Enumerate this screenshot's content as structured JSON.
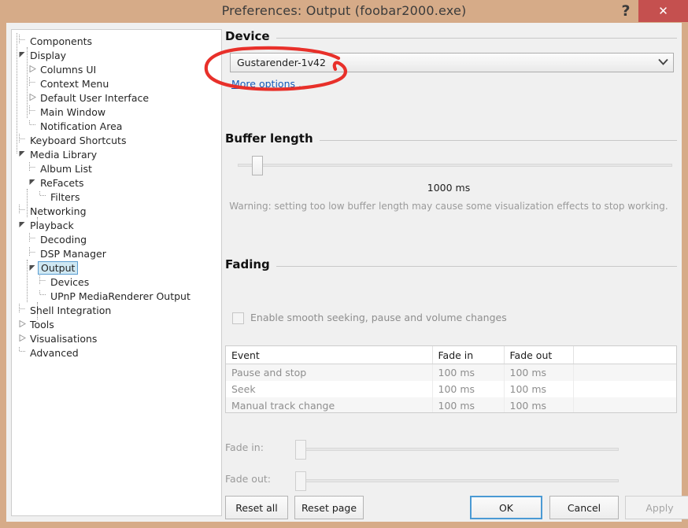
{
  "window": {
    "title": "Preferences: Output (foobar2000.exe)",
    "help_label": "?",
    "close_label": "✕",
    "accent_titlebar": "#d6ab88",
    "accent_close": "#c5504f"
  },
  "sidebar": {
    "items": [
      {
        "label": "Components",
        "indent": 0,
        "twisty": "none",
        "selected": false
      },
      {
        "label": "Display",
        "indent": 0,
        "twisty": "expanded",
        "selected": false
      },
      {
        "label": "Columns UI",
        "indent": 1,
        "twisty": "collapsed",
        "selected": false
      },
      {
        "label": "Context Menu",
        "indent": 1,
        "twisty": "none",
        "selected": false
      },
      {
        "label": "Default User Interface",
        "indent": 1,
        "twisty": "collapsed",
        "selected": false
      },
      {
        "label": "Main Window",
        "indent": 1,
        "twisty": "none",
        "selected": false
      },
      {
        "label": "Notification Area",
        "indent": 1,
        "twisty": "none",
        "selected": false
      },
      {
        "label": "Keyboard Shortcuts",
        "indent": 0,
        "twisty": "none",
        "selected": false
      },
      {
        "label": "Media Library",
        "indent": 0,
        "twisty": "expanded",
        "selected": false
      },
      {
        "label": "Album List",
        "indent": 1,
        "twisty": "none",
        "selected": false
      },
      {
        "label": "ReFacets",
        "indent": 1,
        "twisty": "expanded",
        "selected": false
      },
      {
        "label": "Filters",
        "indent": 2,
        "twisty": "none",
        "selected": false
      },
      {
        "label": "Networking",
        "indent": 0,
        "twisty": "none",
        "selected": false
      },
      {
        "label": "Playback",
        "indent": 0,
        "twisty": "expanded",
        "selected": false
      },
      {
        "label": "Decoding",
        "indent": 1,
        "twisty": "none",
        "selected": false
      },
      {
        "label": "DSP Manager",
        "indent": 1,
        "twisty": "none",
        "selected": false
      },
      {
        "label": "Output",
        "indent": 1,
        "twisty": "expanded",
        "selected": true
      },
      {
        "label": "Devices",
        "indent": 2,
        "twisty": "none",
        "selected": false
      },
      {
        "label": "UPnP MediaRenderer Output",
        "indent": 2,
        "twisty": "none",
        "selected": false
      },
      {
        "label": "Shell Integration",
        "indent": 0,
        "twisty": "none",
        "selected": false
      },
      {
        "label": "Tools",
        "indent": 0,
        "twisty": "collapsed",
        "selected": false
      },
      {
        "label": "Visualisations",
        "indent": 0,
        "twisty": "collapsed",
        "selected": false
      },
      {
        "label": "Advanced",
        "indent": 0,
        "twisty": "none",
        "selected": false
      }
    ]
  },
  "device": {
    "group_title": "Device",
    "selected": "Gustarender-1v42",
    "chevron": "⌄",
    "more_options": "More options ..."
  },
  "buffer": {
    "group_title": "Buffer length",
    "value_label": "1000 ms",
    "warning": "Warning: setting too low buffer length may cause some visualization effects to stop working."
  },
  "fading": {
    "group_title": "Fading",
    "checkbox_label": "Enable smooth seeking, pause and volume changes",
    "checkbox_checked": false,
    "table": {
      "headers": [
        "Event",
        "Fade in",
        "Fade out",
        ""
      ],
      "rows": [
        [
          "Pause and stop",
          "100 ms",
          "100 ms",
          ""
        ],
        [
          "Seek",
          "100 ms",
          "100 ms",
          ""
        ],
        [
          "Manual track change",
          "100 ms",
          "100 ms",
          ""
        ]
      ]
    },
    "fade_in_label": "Fade in:",
    "fade_out_label": "Fade out:"
  },
  "footer": {
    "reset_all": "Reset all",
    "reset_page": "Reset page",
    "ok": "OK",
    "cancel": "Cancel",
    "apply": "Apply"
  },
  "annotation": {
    "type": "hand-drawn-ellipse",
    "color": "#e8302a",
    "target": "device-combobox"
  }
}
